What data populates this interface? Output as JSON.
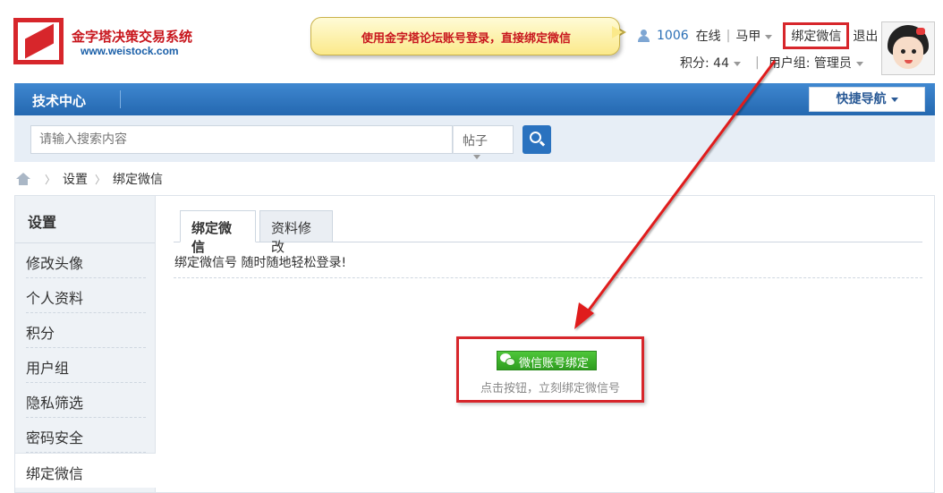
{
  "brand": {
    "title": "金字塔决策交易系统",
    "url": "www.weistock.com"
  },
  "callout": {
    "text": "使用金字塔论坛账号登录，直接绑定微信"
  },
  "userbar": {
    "online_count": "1006",
    "online_label": "在线",
    "username": "马甲",
    "bind_wechat": "绑定微信",
    "logout": "退出",
    "points_label": "积分: 44",
    "usergroup_label": "用户组: 管理员"
  },
  "nav": {
    "title": "技术中心",
    "quick_nav": "快捷导航"
  },
  "search": {
    "placeholder": "请输入搜索内容",
    "type": "帖子"
  },
  "breadcrumb": {
    "items": [
      "设置",
      "绑定微信"
    ]
  },
  "sidebar": {
    "title": "设置",
    "items": [
      {
        "label": "修改头像"
      },
      {
        "label": "个人资料"
      },
      {
        "label": "积分"
      },
      {
        "label": "用户组"
      },
      {
        "label": "隐私筛选"
      },
      {
        "label": "密码安全"
      },
      {
        "label": "绑定微信",
        "active": true
      }
    ]
  },
  "main": {
    "tabs": [
      {
        "label": "绑定微信",
        "active": true
      },
      {
        "label": "资料修改",
        "active": false
      }
    ],
    "description": "绑定微信号 随时随地轻松登录!",
    "bind_button": "微信账号绑定",
    "bind_tip": "点击按钮，立刻绑定微信号"
  },
  "colors": {
    "accent_blue": "#2468b0",
    "highlight_red": "#d7262b",
    "wechat_green": "#3bb12a"
  }
}
